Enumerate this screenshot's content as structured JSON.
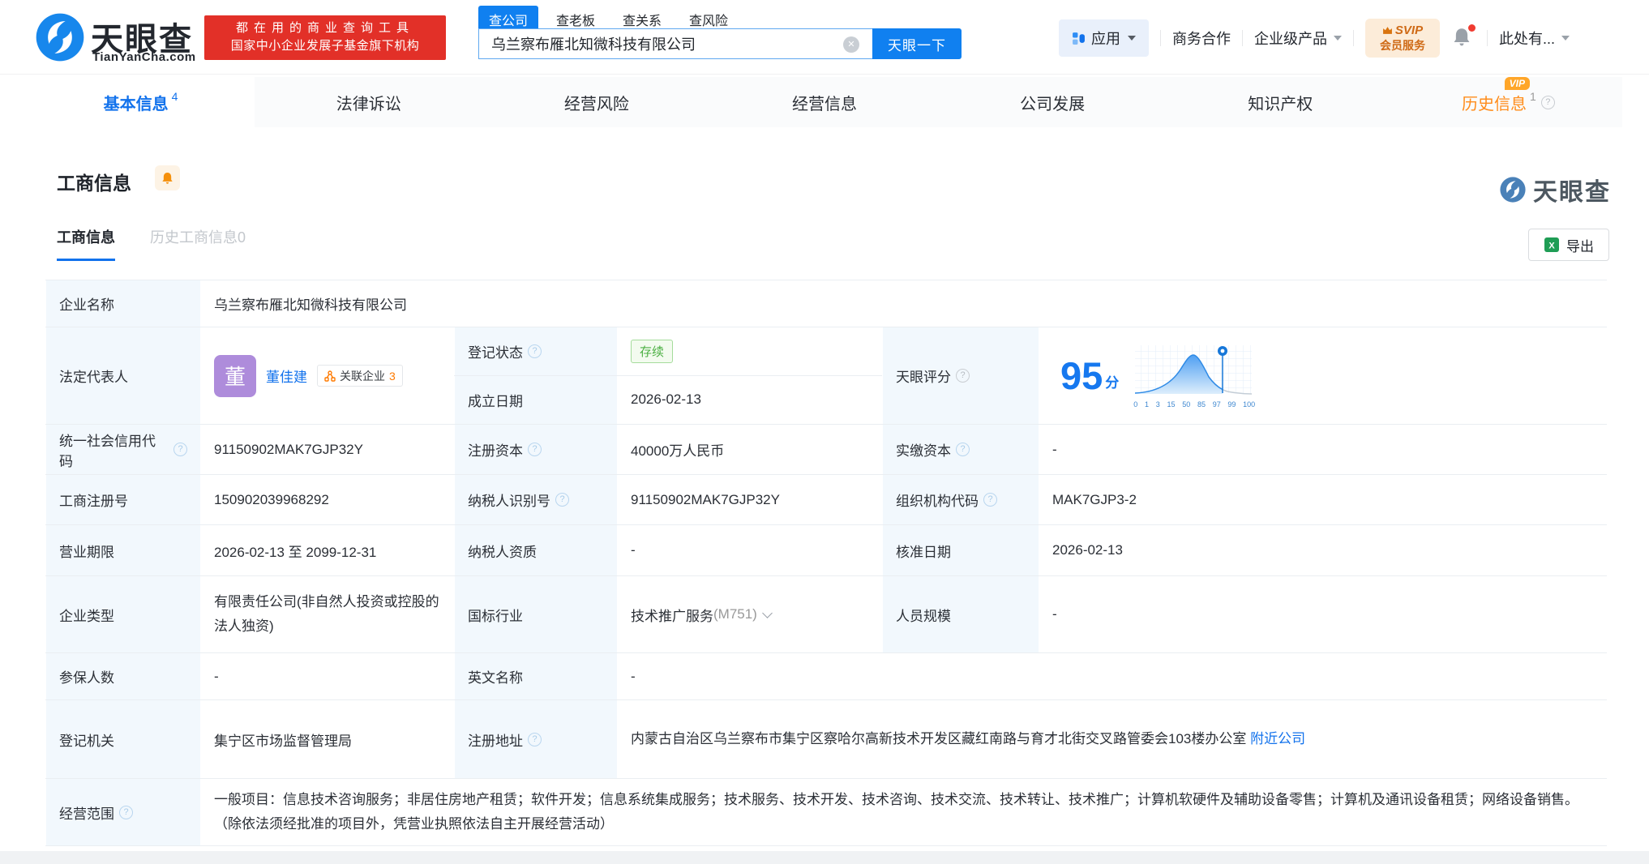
{
  "header": {
    "brand": {
      "name": "天眼查",
      "domain": "TianYanCha.com"
    },
    "promo": {
      "line1": "都在用的商业查询工具",
      "line2": "国家中小企业发展子基金旗下机构"
    },
    "search": {
      "tabs": [
        {
          "label": "查公司",
          "active": true
        },
        {
          "label": "查老板",
          "active": false
        },
        {
          "label": "查关系",
          "active": false
        },
        {
          "label": "查风险",
          "active": false
        }
      ],
      "value": "乌兰察布雁北知微科技有限公司",
      "button": "天眼一下"
    },
    "menu": {
      "apps": "应用",
      "cooperation": "商务合作",
      "enterprise": "企业级产品",
      "svip_top": "SVIP",
      "svip_bottom": "会员服务",
      "user": "此处有..."
    }
  },
  "nav": {
    "tabs": [
      {
        "label": "基本信息",
        "count": "4"
      },
      {
        "label": "法律诉讼"
      },
      {
        "label": "经营风险"
      },
      {
        "label": "经营信息"
      },
      {
        "label": "公司发展"
      },
      {
        "label": "知识产权"
      },
      {
        "label": "历史信息",
        "count": "1",
        "vip": "VIP"
      }
    ]
  },
  "section": {
    "title": "工商信息",
    "watermark": "天眼查",
    "subtab_active": "工商信息",
    "subtab_inactive": "历史工商信息0",
    "export_label": "导出"
  },
  "table": {
    "company_name": {
      "label": "企业名称",
      "value": "乌兰察布雁北知微科技有限公司"
    },
    "legal_rep": {
      "label": "法定代表人",
      "avatar": "董",
      "name": "董佳建",
      "related_label": "关联企业",
      "related_count": "3"
    },
    "reg_status": {
      "label": "登记状态",
      "value": "存续"
    },
    "establish_date": {
      "label": "成立日期",
      "value": "2026-02-13"
    },
    "score": {
      "label": "天眼评分",
      "value": "95",
      "unit": "分",
      "axis": [
        "0",
        "1",
        "3",
        "15",
        "50",
        "85",
        "97",
        "99",
        "100"
      ]
    },
    "credit_code": {
      "label": "统一社会信用代码",
      "value": "91150902MAK7GJP32Y"
    },
    "reg_capital": {
      "label": "注册资本",
      "value": "40000万人民币"
    },
    "paid_capital": {
      "label": "实缴资本",
      "value": "-"
    },
    "reg_number": {
      "label": "工商注册号",
      "value": "150902039968292"
    },
    "taxpayer_id": {
      "label": "纳税人识别号",
      "value": "91150902MAK7GJP32Y"
    },
    "org_code": {
      "label": "组织机构代码",
      "value": "MAK7GJP3-2"
    },
    "business_term": {
      "label": "营业期限",
      "value": "2026-02-13 至 2099-12-31"
    },
    "taxpayer_quality": {
      "label": "纳税人资质",
      "value": "-"
    },
    "approval_date": {
      "label": "核准日期",
      "value": "2026-02-13"
    },
    "company_type": {
      "label": "企业类型",
      "value": "有限责任公司(非自然人投资或控股的法人独资)"
    },
    "industry": {
      "label": "国标行业",
      "value": "技术推广服务",
      "code": "(M751)"
    },
    "staff_size": {
      "label": "人员规模",
      "value": "-"
    },
    "insured_count": {
      "label": "参保人数",
      "value": "-"
    },
    "english_name": {
      "label": "英文名称",
      "value": "-"
    },
    "reg_authority": {
      "label": "登记机关",
      "value": "集宁区市场监督管理局"
    },
    "reg_address": {
      "label": "注册地址",
      "value": "内蒙古自治区乌兰察布市集宁区察哈尔高新技术开发区藏红南路与育才北街交叉路管委会103楼办公室",
      "link": "附近公司"
    },
    "business_scope": {
      "label": "经营范围",
      "value": "一般项目：信息技术咨询服务；非居住房地产租赁；软件开发；信息系统集成服务；技术服务、技术开发、技术咨询、技术交流、技术转让、技术推广；计算机软硬件及辅助设备零售；计算机及通讯设备租赁；网络设备销售。（除依法须经批准的项目外，凭营业执照依法自主开展经营活动）"
    }
  },
  "colors": {
    "accent_blue": "#1272ec",
    "search_blue": "#1080f0",
    "promo_red": "#e23028",
    "status_green": "#4cb043",
    "history_orange": "#ff8c1a",
    "avatar_purple": "#ae8cdb",
    "label_cell_bg": "#f2f8fd"
  }
}
